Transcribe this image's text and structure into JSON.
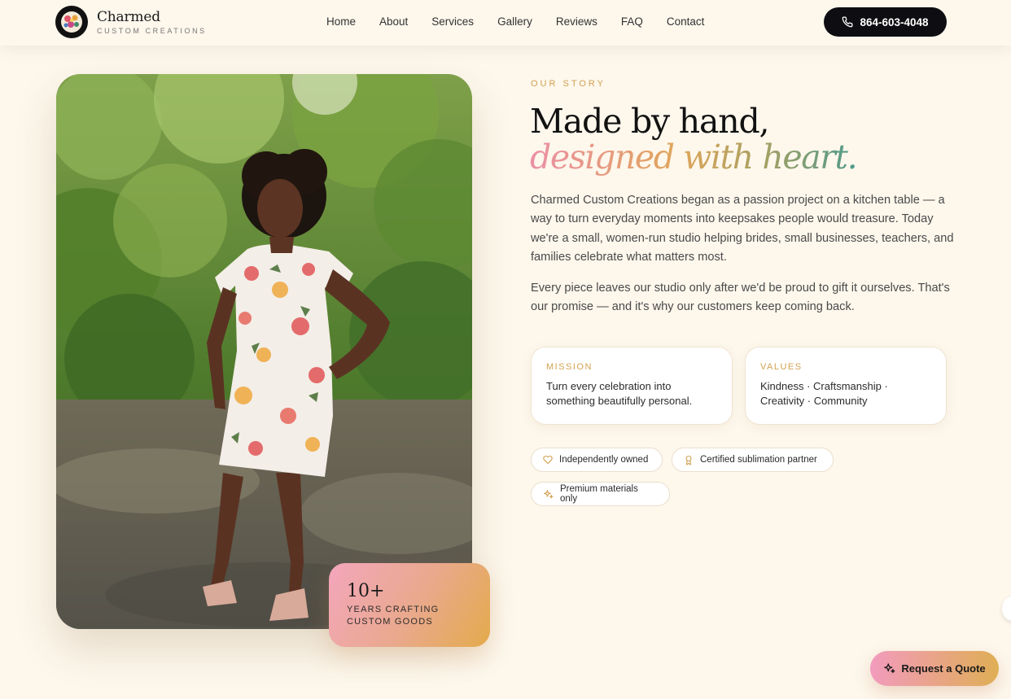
{
  "brand": {
    "name": "Charmed",
    "tagline": "CUSTOM CREATIONS",
    "logo_icon": "floral-logo-icon"
  },
  "nav": {
    "items": [
      "Home",
      "About",
      "Services",
      "Gallery",
      "Reviews",
      "FAQ",
      "Contact"
    ]
  },
  "phone": {
    "label": "864-603-4048",
    "icon": "phone-icon"
  },
  "about": {
    "eyebrow": "OUR STORY",
    "headline_line1": "Made by hand,",
    "headline_line2": "designed with heart.",
    "paragraph1": "Charmed Custom Creations began as a passion project on a kitchen table — a way to turn everyday moments into keepsakes people would treasure. Today we're a small, women-run studio helping brides, small businesses, teachers, and families celebrate what matters most.",
    "paragraph2": "Every piece leaves our studio only after we'd be proud to gift it ourselves. That's our promise — and it's why our customers keep coming back.",
    "cards": [
      {
        "title": "MISSION",
        "text": "Turn every celebration into something beautifully personal."
      },
      {
        "title": "VALUES",
        "text": "Kindness · Craftsmanship · Creativity · Community"
      }
    ],
    "pills": [
      {
        "label": "Independently owned",
        "icon": "heart-icon"
      },
      {
        "label": "Certified sublimation partner",
        "icon": "award-icon"
      },
      {
        "label": "Premium materials only",
        "icon": "sparkle-icon"
      }
    ]
  },
  "experience_badge": {
    "value": "10+",
    "label": "YEARS CRAFTING CUSTOM GOODS"
  },
  "quote_button": {
    "label": "Request a Quote",
    "icon": "sparkle-icon"
  },
  "colors": {
    "background": "#fdf7ec",
    "gold": "#d2a252",
    "dark": "#0e0e12",
    "pink": "#f29bbd"
  }
}
